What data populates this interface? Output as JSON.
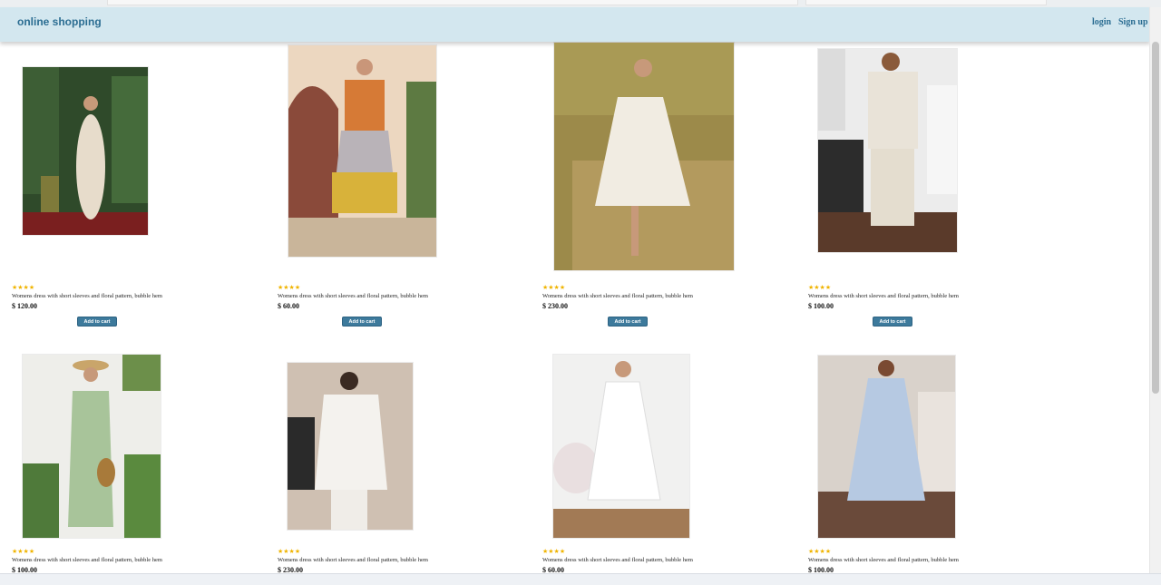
{
  "header": {
    "brand": "online shopping",
    "login_label": "login",
    "signup_label": "Sign up"
  },
  "products": [
    {
      "rating": "★★★★",
      "description": "Womens dress with short sleeves and floral pattern, bubble hem",
      "price": "$ 120.00",
      "button": "Add to cart"
    },
    {
      "rating": "★★★★",
      "description": "Womens dress with short sleeves and floral pattern, bubble hem",
      "price": "$ 60.00",
      "button": "Add to cart"
    },
    {
      "rating": "★★★★",
      "description": "Womens dress with short sleeves and floral pattern, bubble hem",
      "price": "$ 230.00",
      "button": "Add to cart"
    },
    {
      "rating": "★★★★",
      "description": "Womens dress with short sleeves and floral pattern, bubble hem",
      "price": "$ 100.00",
      "button": "Add to cart"
    },
    {
      "rating": "★★★★",
      "description": "Womens dress with short sleeves and floral pattern, bubble hem",
      "price": "$ 100.00"
    },
    {
      "rating": "★★★★",
      "description": "Womens dress with short sleeves and floral pattern, bubble hem",
      "price": "$ 230.00"
    },
    {
      "rating": "★★★★",
      "description": "Womens dress with short sleeves and floral pattern, bubble hem",
      "price": "$ 60.00"
    },
    {
      "rating": "★★★★",
      "description": "Womens dress with short sleeves and floral pattern, bubble hem",
      "price": "$ 100.00"
    }
  ],
  "colors": {
    "navbar": "#d3e7ef",
    "brand": "#2b6d92",
    "button": "#3d7a9c",
    "stars": "#f0b400"
  }
}
